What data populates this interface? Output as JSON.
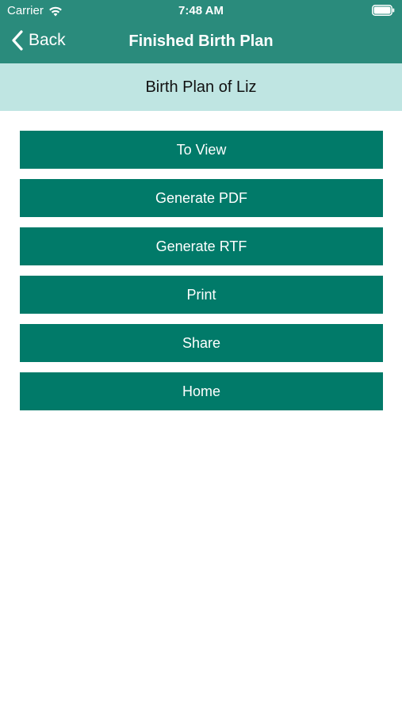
{
  "status_bar": {
    "carrier": "Carrier",
    "time": "7:48 AM"
  },
  "nav": {
    "back_label": "Back",
    "title": "Finished Birth Plan"
  },
  "subheader": {
    "title": "Birth Plan of Liz"
  },
  "actions": {
    "to_view": "To View",
    "generate_pdf": "Generate PDF",
    "generate_rtf": "Generate RTF",
    "print": "Print",
    "share": "Share",
    "home": "Home"
  },
  "colors": {
    "nav_bar": "#2a8b7c",
    "subheader_bg": "#bfe5e2",
    "button_bg": "#017a69",
    "button_text": "#ffffff"
  },
  "icons": {
    "wifi": "wifi-icon",
    "battery": "battery-icon",
    "back": "chevron-left-icon"
  }
}
